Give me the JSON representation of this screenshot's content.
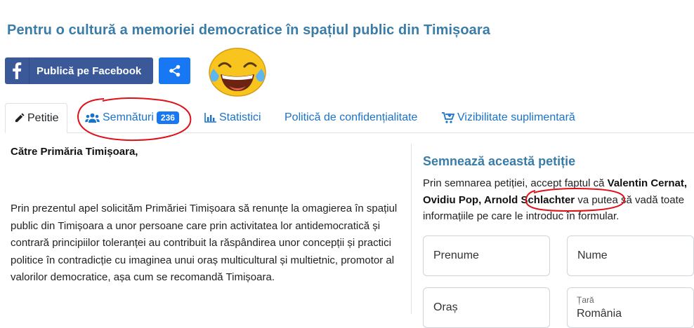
{
  "page": {
    "title": "Pentru o cultură a memoriei democratice în spațiul public din Timișoara"
  },
  "actions": {
    "facebook_label": "Publică pe Facebook",
    "share_icon": "share-icon",
    "emoji": "tears-of-joy-emoji"
  },
  "tabs": [
    {
      "label": "Petitie",
      "icon": "pencil-icon",
      "active": true
    },
    {
      "label": "Semnături",
      "icon": "users-icon",
      "badge": "236"
    },
    {
      "label": "Statistici",
      "icon": "bar-chart-icon"
    },
    {
      "label": "Politică de confidențialitate"
    },
    {
      "label": "Vizibilitate suplimentară",
      "icon": "cart-plus-icon"
    }
  ],
  "petition": {
    "addressee": "Către Primăria Timișoara,",
    "body": "Prin prezentul apel solicităm Primăriei Timișoara să renunțe la omagierea în spațiul public din Timișoara a unor persoane care prin activitatea lor antidemocratică și contrară principiilor toleranței au contribuit la răspândirea unor concepții și practici politice în contradicție cu imaginea unui oraș multicultural și multietnic, promotor al valorilor democratice, așa cum se recomandă Timișoara."
  },
  "sign": {
    "title": "Semnează această petiție",
    "consent_prefix": "Prin semnarea petiției, accept faptul că ",
    "authors_1": "Valentin Cernat, Ovidiu Pop, ",
    "authors_2": "Arnold Schlachter",
    "consent_suffix": " va putea să vadă toate informațiile pe care le introduc în formular.",
    "fields": {
      "first_name": "Prenume",
      "last_name": "Nume",
      "city": "Oraș",
      "country_label": "Țară",
      "country_value": "România"
    }
  },
  "colors": {
    "title": "#3a7ca8",
    "link": "#1a73c9",
    "facebook": "#3b5998",
    "share": "#1877f2",
    "annotation": "#e0101a"
  }
}
